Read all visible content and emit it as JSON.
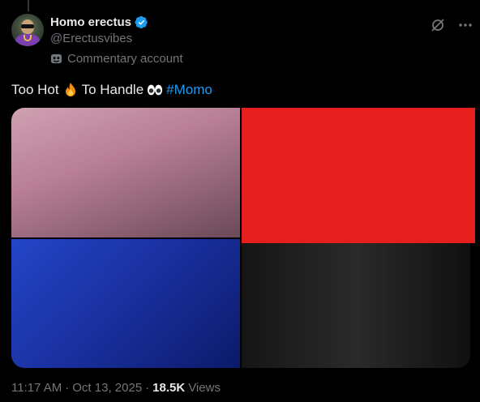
{
  "author": {
    "display_name": "Homo erectus",
    "handle": "@Erectusvibes",
    "label": "Commentary account"
  },
  "icons": {
    "verified": "verified-badge-icon",
    "label": "mask-icon",
    "grok": "grok-icon",
    "more": "more-icon"
  },
  "tweet": {
    "text_part1": "Too Hot",
    "emoji1": "fire",
    "text_part2": "To Handle",
    "emoji2": "eyes",
    "hashtag": "#Momo"
  },
  "media": {
    "count": 4,
    "redaction_color": "#e51f1e"
  },
  "meta": {
    "time": "11:17 AM",
    "sep1": "·",
    "date": "Oct 13, 2025",
    "sep2": "·",
    "views_count": "18.5K",
    "views_label": "Views"
  },
  "colors": {
    "background": "#000000",
    "text": "#e7e9ea",
    "secondary": "#71767b",
    "link": "#1d9bf0",
    "verified": "#1d9bf0"
  }
}
